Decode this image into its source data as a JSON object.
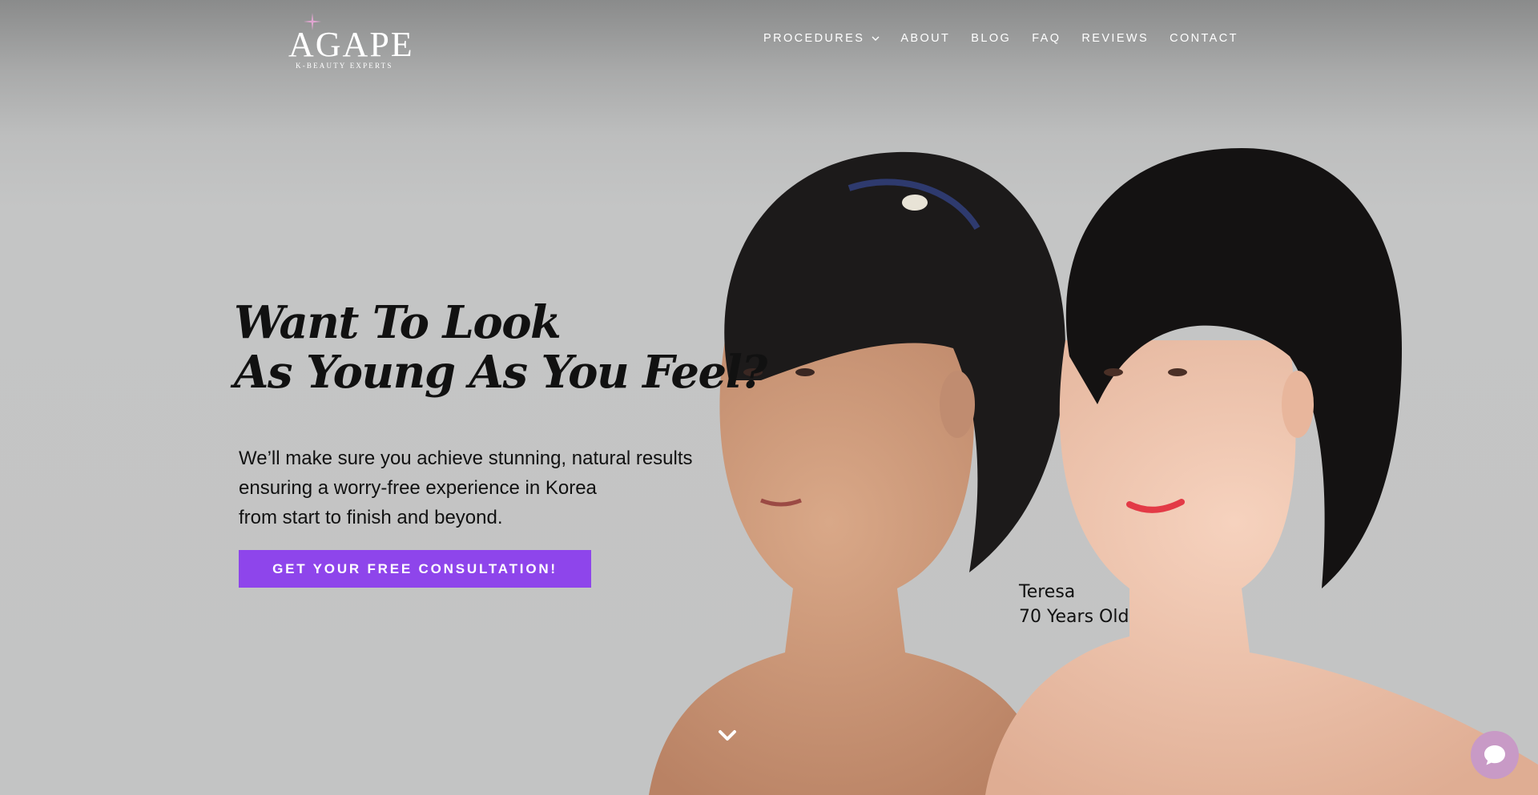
{
  "brand": {
    "name": "AGAPE",
    "tagline": "K-BEAUTY EXPERTS"
  },
  "nav": {
    "items": [
      {
        "label": "PROCEDURES",
        "has_dropdown": true
      },
      {
        "label": "ABOUT"
      },
      {
        "label": "BLOG"
      },
      {
        "label": "FAQ"
      },
      {
        "label": "REVIEWS"
      },
      {
        "label": "CONTACT"
      }
    ]
  },
  "hero": {
    "headline_line1": "Want To Look",
    "headline_line2": "As Young As You Feel?",
    "sub_line1": "We’ll make sure you achieve stunning, natural results",
    "sub_line2": "ensuring a worry-free experience in Korea",
    "sub_line3": "from start to finish and beyond.",
    "cta_label": "GET YOUR FREE CONSULTATION!",
    "photo": {
      "caption_name": "Teresa",
      "caption_age": "70 Years Old"
    }
  },
  "icons": {
    "scroll": "chevron-down-icon",
    "chat": "chat-bubble-icon",
    "logo_star": "sparkle-icon"
  },
  "colors": {
    "accent": "#8e45eb",
    "chat_button": "#c89ac6",
    "text_dark": "#111111",
    "nav_text": "#ffffff",
    "background": "#c3c4c4"
  }
}
